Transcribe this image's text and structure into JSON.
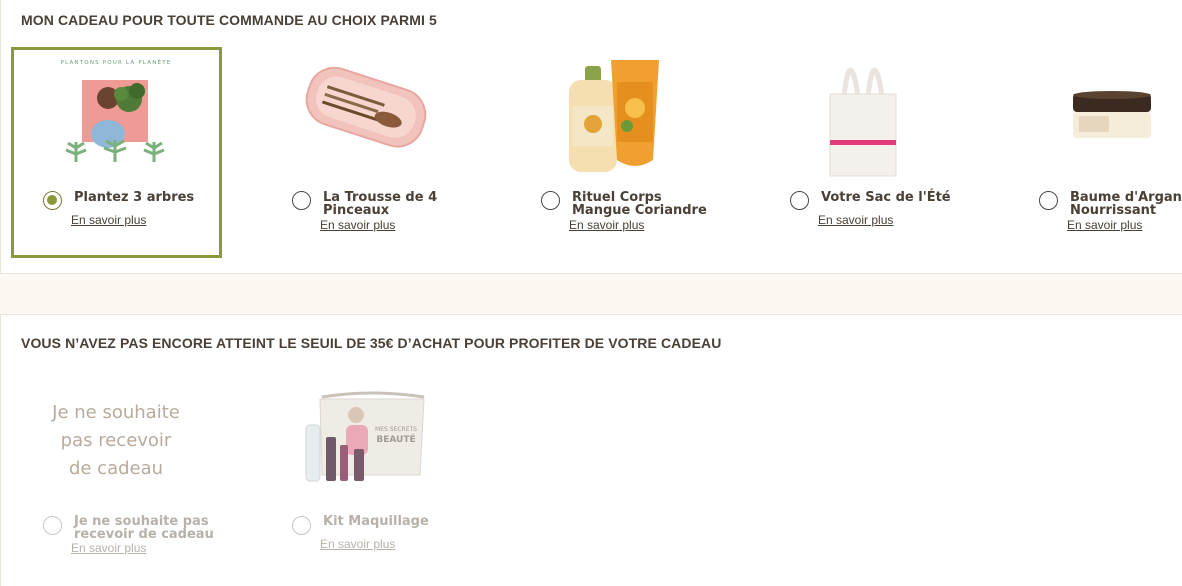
{
  "section1": {
    "title": "MON CADEAU POUR TOUTE COMMANDE AU CHOIX PARMI 5",
    "gifts": [
      {
        "image_caption": "PLANTONS POUR LA PLANÈTE",
        "label": "Plantez 3 arbres",
        "link": "En savoir plus",
        "selected": true
      },
      {
        "label": "La Trousse de 4 Pinceaux",
        "link": "En savoir plus",
        "selected": false
      },
      {
        "label": "Rituel Corps Mangue Coriandre",
        "link": "En savoir plus",
        "selected": false
      },
      {
        "label": "Votre Sac de l'Été",
        "link": "En savoir plus",
        "selected": false
      },
      {
        "label": "Baume d'Argan Nourrissant",
        "link": "En savoir plus",
        "selected": false
      }
    ]
  },
  "section2": {
    "title": "VOUS N’AVEZ PAS ENCORE ATTEINT LE SEUIL DE 35€ D’ACHAT POUR PROFITER DE VOTRE CADEAU",
    "gifts": [
      {
        "image_text": [
          "Je ne souhaite",
          "pas recevoir",
          "de cadeau"
        ],
        "label": "Je ne souhaite pas recevoir de cadeau",
        "link": "En savoir plus"
      },
      {
        "image_text": [
          "MES SECRETS",
          "BEAUTÉ"
        ],
        "label": "Kit Maquillage",
        "link": "En savoir plus"
      }
    ]
  },
  "colors": {
    "accent": "#8a9a3a",
    "text": "#4a4036",
    "disabled": "#b7b1aa",
    "band": "#fcf7f1"
  }
}
